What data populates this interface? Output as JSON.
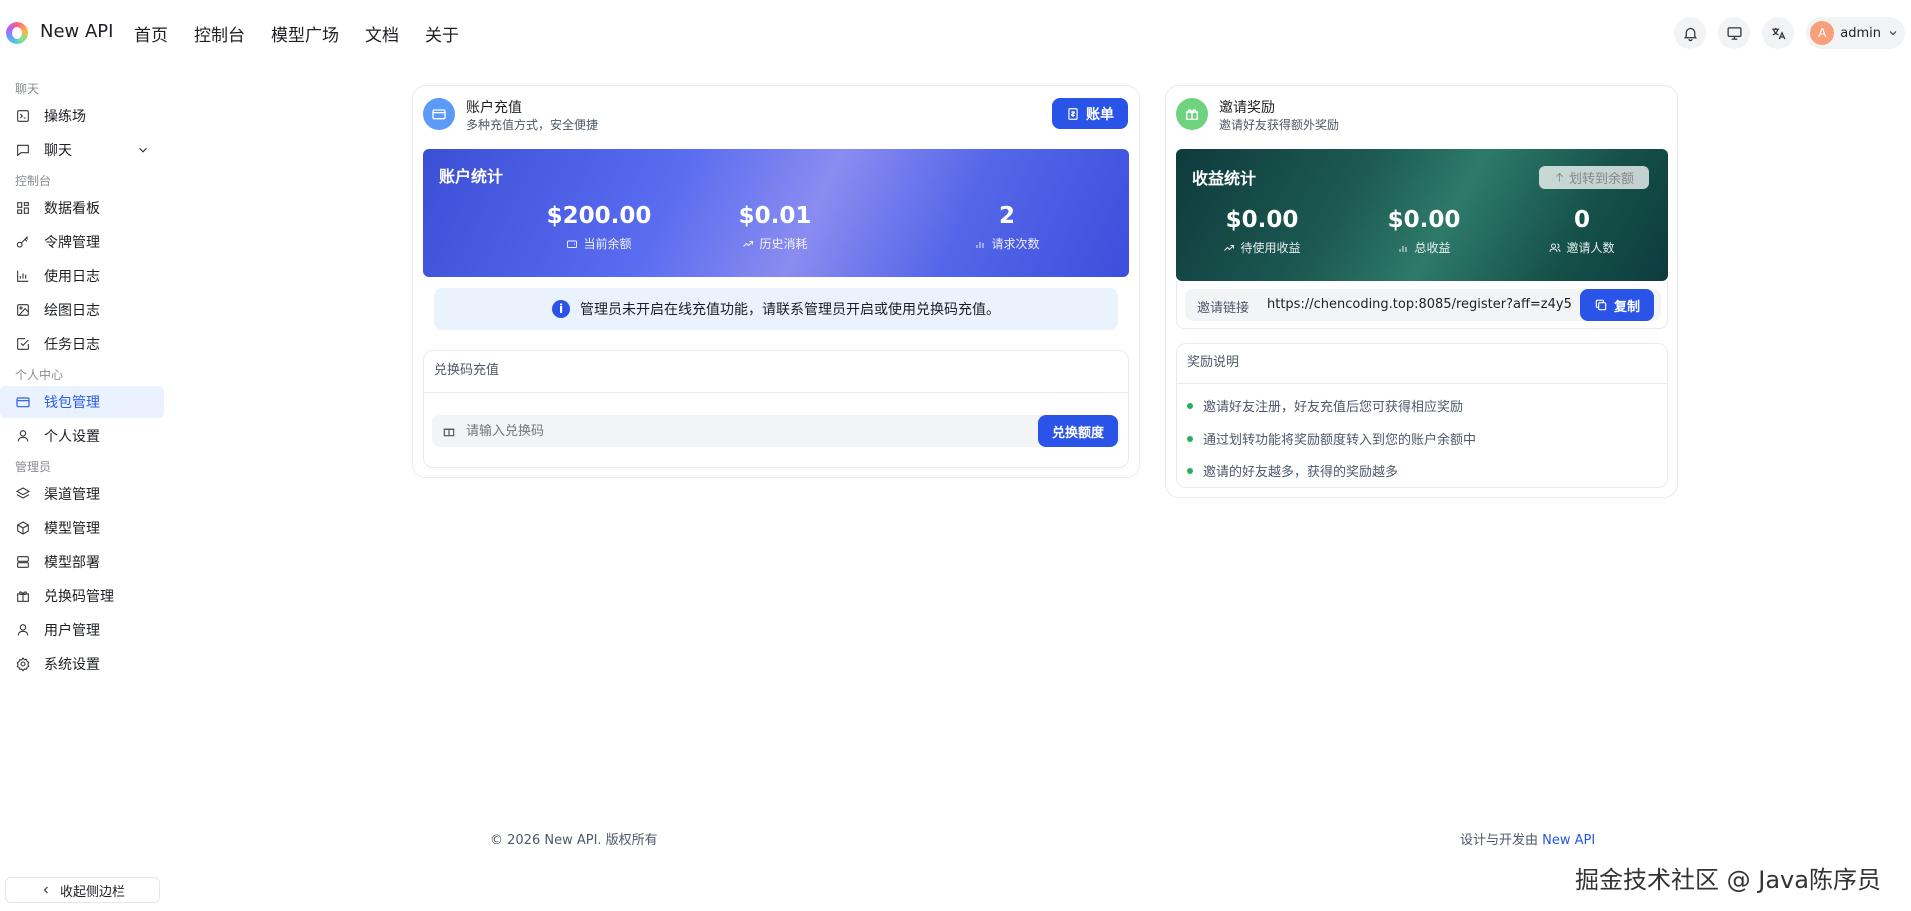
{
  "header": {
    "brand": "New API",
    "nav": [
      "首页",
      "控制台",
      "模型广场",
      "文档",
      "关于"
    ],
    "user": {
      "avatar_letter": "A",
      "name": "admin"
    }
  },
  "sidebar": {
    "sections": [
      {
        "title": "聊天",
        "items": [
          {
            "label": "操练场",
            "icon": "playground-icon"
          },
          {
            "label": "聊天",
            "icon": "chat-icon",
            "expandable": true
          }
        ]
      },
      {
        "title": "控制台",
        "items": [
          {
            "label": "数据看板",
            "icon": "dashboard-icon"
          },
          {
            "label": "令牌管理",
            "icon": "key-icon"
          },
          {
            "label": "使用日志",
            "icon": "chart-icon"
          },
          {
            "label": "绘图日志",
            "icon": "image-icon"
          },
          {
            "label": "任务日志",
            "icon": "task-icon"
          }
        ]
      },
      {
        "title": "个人中心",
        "items": [
          {
            "label": "钱包管理",
            "icon": "wallet-icon",
            "active": true
          },
          {
            "label": "个人设置",
            "icon": "user-icon"
          }
        ]
      },
      {
        "title": "管理员",
        "items": [
          {
            "label": "渠道管理",
            "icon": "layers-icon"
          },
          {
            "label": "模型管理",
            "icon": "cube-icon"
          },
          {
            "label": "模型部署",
            "icon": "server-icon"
          },
          {
            "label": "兑换码管理",
            "icon": "gift-icon"
          },
          {
            "label": "用户管理",
            "icon": "user-icon"
          },
          {
            "label": "系统设置",
            "icon": "gear-icon"
          }
        ]
      }
    ],
    "collapse_label": "收起侧边栏"
  },
  "recharge": {
    "title": "账户充值",
    "subtitle": "多种充值方式，安全便捷",
    "bill_button": "账单",
    "stats_title": "账户统计",
    "stats": [
      {
        "value": "$200.00",
        "label": "当前余额"
      },
      {
        "value": "$0.01",
        "label": "历史消耗"
      },
      {
        "value": "2",
        "label": "请求次数"
      }
    ],
    "notice": "管理员未开启在线充值功能，请联系管理员开启或使用兑换码充值。",
    "redeem_title": "兑换码充值",
    "redeem_placeholder": "请输入兑换码",
    "redeem_button": "兑换额度"
  },
  "invite": {
    "title": "邀请奖励",
    "subtitle": "邀请好友获得额外奖励",
    "stats_title": "收益统计",
    "transfer_button": "划转到余额",
    "stats": [
      {
        "value": "$0.00",
        "label": "待使用收益"
      },
      {
        "value": "$0.00",
        "label": "总收益"
      },
      {
        "value": "0",
        "label": "邀请人数"
      }
    ],
    "link_label": "邀请链接",
    "link_value": "https://chencoding.top:8085/register?aff=z4y5",
    "copy_button": "复制",
    "rules_title": "奖励说明",
    "rules": [
      "邀请好友注册，好友充值后您可获得相应奖励",
      "通过划转功能将奖励额度转入到您的账户余额中",
      "邀请的好友越多，获得的奖励越多"
    ]
  },
  "footer": {
    "copyright": "© 2026 New API. 版权所有",
    "designed_by": "设计与开发由",
    "designed_link": "New API"
  },
  "watermark": "掘金技术社区 @ Java陈序员",
  "colors": {
    "accent": "#2a54e8",
    "active_bg": "#eaf1ff",
    "success": "#22b35e"
  }
}
